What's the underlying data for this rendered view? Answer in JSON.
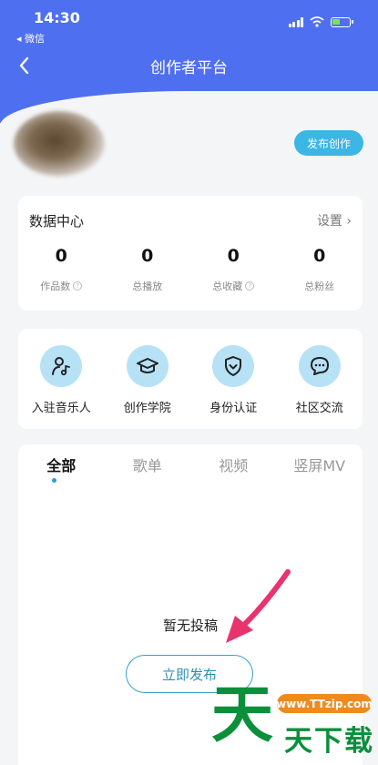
{
  "status_bar": {
    "time": "14:30",
    "back_app": "◂ 微信"
  },
  "nav": {
    "title": "创作者平台",
    "back_icon": "chevron-left-icon"
  },
  "profile": {
    "publish_button": "发布创作"
  },
  "data_center": {
    "title": "数据中心",
    "settings": "设置 ›",
    "stats": [
      {
        "value": "0",
        "label": "作品数"
      },
      {
        "value": "0",
        "label": "总播放"
      },
      {
        "value": "0",
        "label": "总收藏"
      },
      {
        "value": "0",
        "label": "总粉丝"
      }
    ]
  },
  "quick_actions": [
    {
      "label": "入驻音乐人",
      "icon": "musician-icon"
    },
    {
      "label": "创作学院",
      "icon": "graduation-cap-icon"
    },
    {
      "label": "身份认证",
      "icon": "shield-check-icon"
    },
    {
      "label": "社区交流",
      "icon": "chat-bubble-icon"
    }
  ],
  "content_tabs": [
    "全部",
    "歌单",
    "视频",
    "竖屏MV"
  ],
  "active_tab": "全部",
  "empty_state": {
    "message": "暂无投稿",
    "button": "立即发布"
  },
  "watermark": {
    "big": "天",
    "pill": "www.TTzip.com",
    "small": "天下载"
  },
  "colors": {
    "header": "#4f6ff1",
    "accent": "#3cb6e4",
    "icon_circle": "#b7e2f6",
    "arrow": "#e8336f",
    "watermark_green": "#0b8f3a",
    "watermark_orange": "#f08a1d"
  }
}
